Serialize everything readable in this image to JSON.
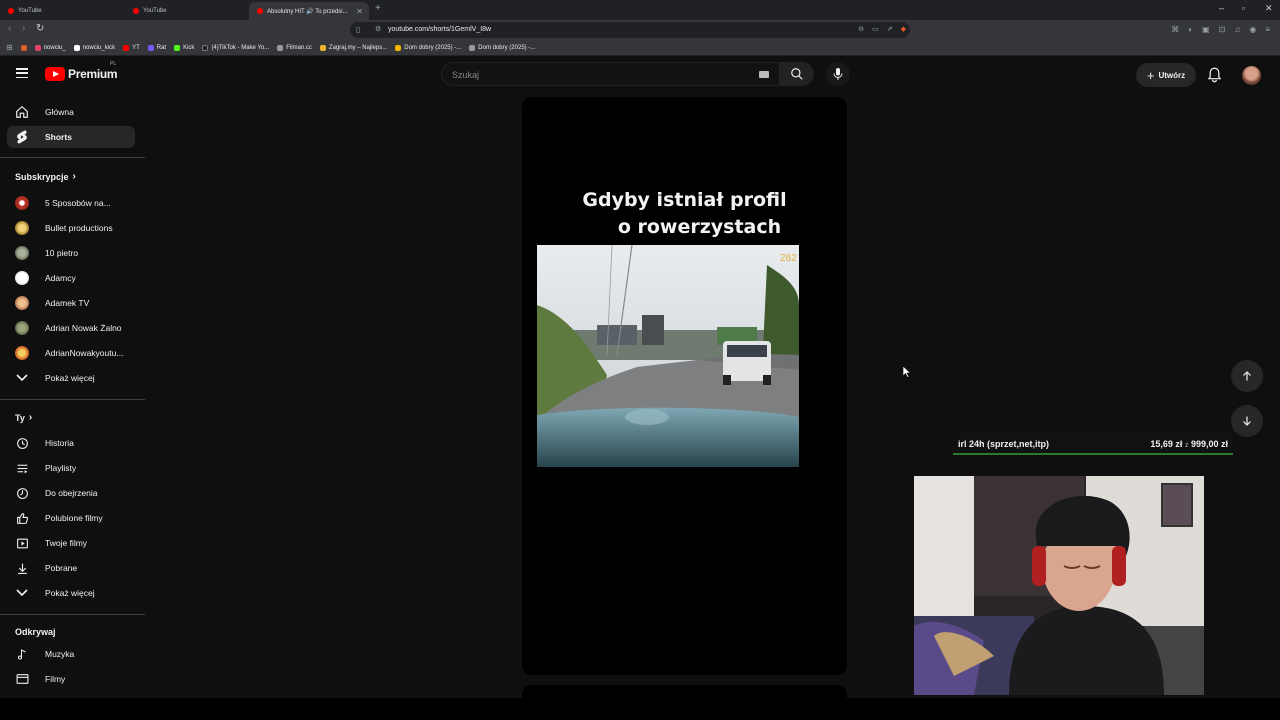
{
  "browser": {
    "tabs": [
      {
        "title": "YouTube",
        "active": false
      },
      {
        "title": "YouTube",
        "active": false
      },
      {
        "title": "Absolutny HIT 🔊 To przedsi...",
        "active": true
      }
    ],
    "url": "youtube.com/shorts/1GemlV_I8w",
    "bookmarks": [
      "nowciu_",
      "nowciu_kick",
      "YT",
      "Rat",
      "Kick",
      "(4)TikTok - Make Yo...",
      "Filman.cc",
      "Zagraj.my – Najleps...",
      "Dom dobry (2025) -...",
      "Dom dobry (2025) -..."
    ]
  },
  "header": {
    "logo_text": "Premium",
    "country_code": "PL",
    "search_placeholder": "Szukaj",
    "create_label": "Utwórz"
  },
  "sidebar": {
    "main": [
      {
        "label": "Główna",
        "icon": "home-icon"
      },
      {
        "label": "Shorts",
        "icon": "shorts-icon",
        "active": true
      }
    ],
    "subs_heading": "Subskrypcje",
    "subscriptions": [
      {
        "label": "5 Sposobów na...",
        "color": "#c0392b"
      },
      {
        "label": "Bullet productions",
        "color": "#c8a04a"
      },
      {
        "label": "10 pietro",
        "color": "#7d8a70"
      },
      {
        "label": "Adamcy",
        "color": "#e8e8e8"
      },
      {
        "label": "Adamek TV",
        "color": "#d08a50"
      },
      {
        "label": "Adrian Nowak Żalno",
        "color": "#6d7a5a"
      },
      {
        "label": "AdrianNowakyoutu...",
        "color": "#d9a030"
      }
    ],
    "show_more_1": "Pokaż więcej",
    "you_heading": "Ty",
    "you_items": [
      {
        "label": "Historia",
        "icon": "history-icon"
      },
      {
        "label": "Playlisty",
        "icon": "playlist-icon"
      },
      {
        "label": "Do obejrzenia",
        "icon": "watch-later-icon"
      },
      {
        "label": "Polubione filmy",
        "icon": "like-icon"
      },
      {
        "label": "Twoje filmy",
        "icon": "your-videos-icon"
      },
      {
        "label": "Pobrane",
        "icon": "download-icon"
      }
    ],
    "show_more_2": "Pokaż więcej",
    "explore_heading": "Odkrywaj",
    "explore_items": [
      {
        "label": "Muzyka",
        "icon": "music-icon"
      },
      {
        "label": "Filmy",
        "icon": "movies-icon"
      }
    ]
  },
  "short": {
    "caption_line1": "Gdyby istniał profil",
    "caption_line2": "o rowerzystach",
    "video_overlay_number": "282"
  },
  "overlay": {
    "goal_label": "irl 24h (sprzet,net,itp)",
    "goal_current": "15,69 zł",
    "goal_separator": "z",
    "goal_target": "999,00 zł"
  }
}
